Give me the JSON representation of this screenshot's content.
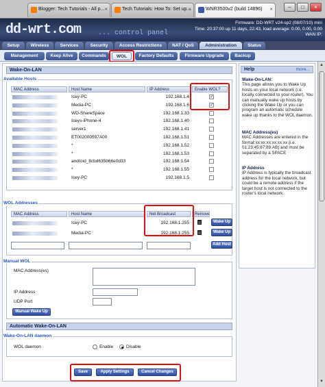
{
  "browser": {
    "tabs": [
      {
        "label": "Blogger: Tech Tutorials - All p...",
        "favicon_color": "#f57d00"
      },
      {
        "label": "Tech Tutorials: How To: Set up...",
        "favicon_color": "#f57d00"
      },
      {
        "label": "WNR3500v2 (build 14896)",
        "favicon_color": "#3a5aa8"
      }
    ]
  },
  "header": {
    "logo": "dd-wrt.com",
    "tagline": "... control panel",
    "firmware": "Firmware: DD-WRT v24-sp2 (08/07/10) mini",
    "time": "Time: 20:37:00 up 11 days, 22:43, load average: 0.00, 0.00, 0.00",
    "wan_ip": "WAN IP:"
  },
  "main_tabs": [
    "Setup",
    "Wireless",
    "Services",
    "Security",
    "Access Restrictions",
    "NAT / QoS",
    "Administration",
    "Status"
  ],
  "active_main_tab": "Administration",
  "sub_tabs": [
    "Management",
    "Keep Alive",
    "Commands",
    "WOL",
    "Factory Defaults",
    "Firmware Upgrade",
    "Backup"
  ],
  "active_sub_tab": "WOL",
  "wol": {
    "section_title": "Wake-On-LAN",
    "available_hosts": {
      "legend": "Available Hosts",
      "columns": [
        "MAC Address",
        "Host Name",
        "IP Address",
        "Enable WOL?"
      ],
      "rows": [
        {
          "host": "Icey-PC",
          "ip": "192.168.1.4",
          "enabled": true
        },
        {
          "host": "Media-PC",
          "ip": "192.168.1.6",
          "enabled": true
        },
        {
          "host": "WD-ShareSpace",
          "ip": "192.168.1.33",
          "enabled": false
        },
        {
          "host": "Iceys-iPhone-4",
          "ip": "192.168.1.40",
          "enabled": false
        },
        {
          "host": "server1",
          "ip": "192.168.1.41",
          "enabled": false
        },
        {
          "host": "ET002000597A00",
          "ip": "192.168.1.51",
          "enabled": false
        },
        {
          "host": "*",
          "ip": "192.168.1.52",
          "enabled": false
        },
        {
          "host": "*",
          "ip": "192.168.1.53",
          "enabled": false
        },
        {
          "host": "android_8cbd635b66e0d33",
          "ip": "192.168.1.54",
          "enabled": false
        },
        {
          "host": "*",
          "ip": "192.168.1.55",
          "enabled": false
        },
        {
          "host": "Icey-PC",
          "ip": "192.168.1.5",
          "enabled": false
        }
      ]
    },
    "wol_addresses": {
      "legend": "WOL Addresses",
      "columns": [
        "MAC Address",
        "Host Name",
        "Net Broadcast",
        "Remove"
      ],
      "rows": [
        {
          "host": "Icey-PC",
          "broadcast": "192.168.1.255",
          "button": "Wake Up"
        },
        {
          "host": "Media-PC",
          "broadcast": "192.168.1.255",
          "button": "Wake Up"
        }
      ],
      "add_button": "Add Host"
    },
    "manual": {
      "legend": "Manual WOL",
      "mac_label": "MAC Address(es)",
      "ip_label": "IP Address",
      "port_label": "UDP Port",
      "button": "Manual Wake Up"
    },
    "auto_title": "Automatic Wake-On-LAN",
    "daemon": {
      "legend": "Wake-On-LAN daemon",
      "label": "WOL daemon",
      "enable": "Enable",
      "disable": "Disable",
      "selected": "Disable"
    },
    "buttons": {
      "save": "Save",
      "apply": "Apply Settings",
      "cancel": "Cancel Changes"
    }
  },
  "help": {
    "title": "Help",
    "more": "more...",
    "sections": [
      {
        "heading": "Wake-On-LAN:",
        "text": "This page allows you to Wake Up hosts on your local network (i.e. locally connected to your router). You can manually wake up hosts by clicking the Wake Up or you can program an automatic schedule wake up thanks to the WOL daemon."
      },
      {
        "heading": "MAC Address(es)",
        "text": "MAC Addresses are entered in the format xx:xx:xx:xx:xx:xx (i.e. 01:23:45:67:89:AB) and must be separated by a SPACE"
      },
      {
        "heading": "IP Address",
        "text": "IP Address is typically the broadcast address for the local network, but could be a remote address if the target host is not connected to the router's local network."
      }
    ]
  },
  "colors": {
    "accent": "#2a55c9",
    "highlight": "#e01010",
    "header": "#2b3a63"
  }
}
